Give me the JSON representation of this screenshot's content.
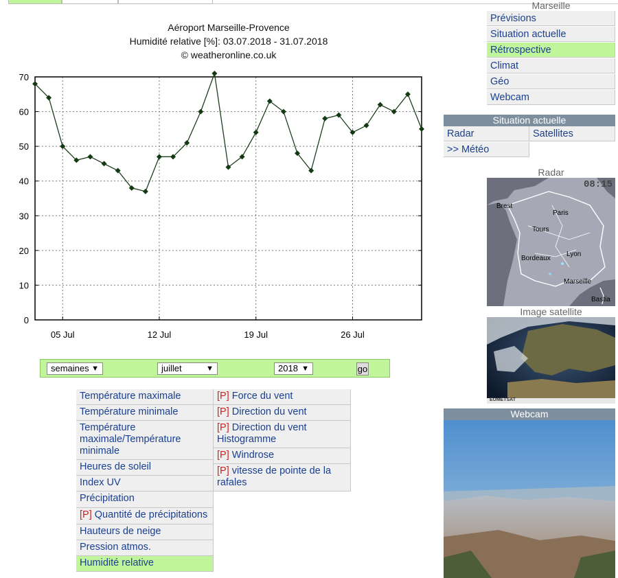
{
  "chart_header": {
    "station": "Aéroport Marseille-Provence",
    "subtitle": "Humidité relative [%]: 03.07.2018 - 31.07.2018",
    "copyright": "© weatheronline.co.uk"
  },
  "chart_data": {
    "type": "line",
    "title": "Humidité relative [%]: 03.07.2018 - 31.07.2018",
    "xlabel": "",
    "ylabel": "",
    "x_tick_labels": [
      "05 Jul",
      "12 Jul",
      "19 Jul",
      "26 Jul"
    ],
    "y_ticks": [
      0,
      10,
      20,
      30,
      40,
      50,
      60,
      70
    ],
    "ylim": [
      0,
      70
    ],
    "grid": true,
    "x": [
      "03.07.2018",
      "04.07.2018",
      "05.07.2018",
      "06.07.2018",
      "07.07.2018",
      "08.07.2018",
      "09.07.2018",
      "10.07.2018",
      "11.07.2018",
      "12.07.2018",
      "13.07.2018",
      "14.07.2018",
      "15.07.2018",
      "16.07.2018",
      "17.07.2018",
      "18.07.2018",
      "19.07.2018",
      "20.07.2018",
      "21.07.2018",
      "22.07.2018",
      "23.07.2018",
      "24.07.2018",
      "25.07.2018",
      "26.07.2018",
      "27.07.2018",
      "28.07.2018",
      "29.07.2018",
      "30.07.2018",
      "31.07.2018"
    ],
    "series": [
      {
        "values": [
          68,
          64,
          50,
          46,
          47,
          45,
          43,
          38,
          37,
          47,
          47,
          51,
          60,
          71,
          44,
          47,
          54,
          63,
          60,
          48,
          43,
          58,
          59,
          54,
          56,
          62,
          60,
          65,
          55
        ]
      }
    ],
    "line_color": "#1e3d1e"
  },
  "selector": {
    "period": "semaines",
    "month": "juillet",
    "year": "2018",
    "go_label": "go",
    "arrow": "▼"
  },
  "params_left": [
    {
      "prefix": "",
      "label": "Température maximale"
    },
    {
      "prefix": "",
      "label": "Température minimale"
    },
    {
      "prefix": "",
      "label": "Température maximale/Température minimale"
    },
    {
      "prefix": "",
      "label": "Heures de soleil"
    },
    {
      "prefix": "",
      "label": "Index UV"
    },
    {
      "prefix": "",
      "label": "Précipitation"
    },
    {
      "prefix": "[P]",
      "label": " Quantité de précipitations"
    },
    {
      "prefix": "",
      "label": "Hauteurs de neige"
    },
    {
      "prefix": "",
      "label": "Pression atmos."
    },
    {
      "prefix": "",
      "label": "Humidité relative"
    }
  ],
  "params_right": [
    {
      "prefix": "[P]",
      "label": " Force du vent"
    },
    {
      "prefix": "[P]",
      "label": " Direction du vent"
    },
    {
      "prefix": "[P]",
      "label": " Direction du vent Histogramme"
    },
    {
      "prefix": "[P]",
      "label": " Windrose"
    },
    {
      "prefix": "[P]",
      "label": " vitesse de pointe de la rafales"
    }
  ],
  "right_nav": {
    "city": "Marseille",
    "items": [
      "Prévisions",
      "Situation actuelle",
      "Rétrospective",
      "Climat",
      "Géo",
      "Webcam"
    ],
    "active": "Rétrospective"
  },
  "situation": {
    "header": "Situation actuelle",
    "radar": "Radar",
    "satellites": "Satellites",
    "meteo": ">> Météo"
  },
  "radar_panel": {
    "title": "Radar",
    "time": "08:15",
    "cities": [
      "Brest",
      "Paris",
      "Tours",
      "Bordeaux",
      "Lyon",
      "Marseille",
      "Bastia"
    ]
  },
  "satellite_panel": {
    "title": "Image satellite",
    "credit": "EUMETSAT"
  },
  "webcam_panel": {
    "title": "Webcam"
  },
  "colors": {
    "active_green": "#c0f59b",
    "link_blue": "#1a3f8f",
    "header_gray": "#7d8e9e",
    "prefix_red": "#cc2222"
  }
}
